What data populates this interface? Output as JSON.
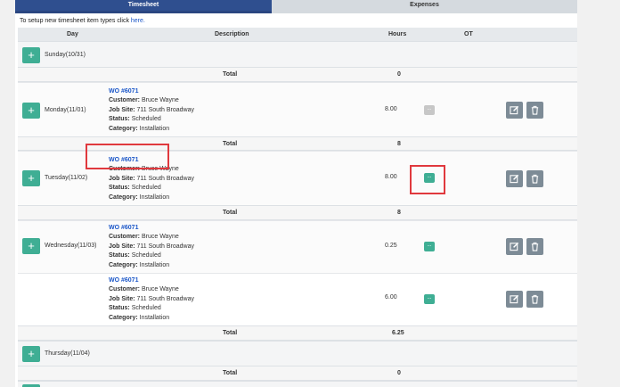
{
  "tabs": {
    "timesheet": "Timesheet",
    "expenses": "Expenses"
  },
  "note": {
    "text": "To setup new timesheet item types click ",
    "link": "here."
  },
  "columns": {
    "day": "Day",
    "description": "Description",
    "hours": "Hours",
    "ot": "OT"
  },
  "labels": {
    "total": "Total",
    "add": "+",
    "ot_button": "...",
    "customer": "Customer:",
    "job_site": "Job Site:",
    "status": "Status:",
    "category": "Category:"
  },
  "days": [
    {
      "name": "Sunday(10/31)",
      "total": "0"
    },
    {
      "name": "Monday(11/01)",
      "total": "8"
    },
    {
      "name": "Tuesday(11/02)",
      "total": "8"
    },
    {
      "name": "Wednesday(11/03)",
      "total": "6.25"
    },
    {
      "name": "Thursday(11/04)",
      "total": "0"
    }
  ],
  "entries": [
    {
      "wo": "WO #6071",
      "customer": "Bruce Wayne",
      "job_site": "711 South Broadway",
      "status": "Scheduled",
      "category": "Installation",
      "hours": "8.00"
    },
    {
      "wo": "WO #6071",
      "customer": "Bruce Wayne",
      "job_site": "711 South Broadway",
      "status": "Scheduled",
      "category": "Installation",
      "hours": "8.00"
    },
    {
      "wo": "WO #6071",
      "customer": "Bruce Wayne",
      "job_site": "711 South Broadway",
      "status": "Scheduled",
      "category": "Installation",
      "hours": "0.25"
    },
    {
      "wo": "WO #6071",
      "customer": "Bruce Wayne",
      "job_site": "711 South Broadway",
      "status": "Scheduled",
      "category": "Installation",
      "hours": "6.00"
    }
  ],
  "colors": {
    "accent": "#3fae94",
    "tab_active": "#2f4f8f",
    "action_button": "#7d8b96",
    "highlight": "#e0393e"
  },
  "icons": {
    "edit": "pencil-square-icon",
    "delete": "trash-icon"
  }
}
